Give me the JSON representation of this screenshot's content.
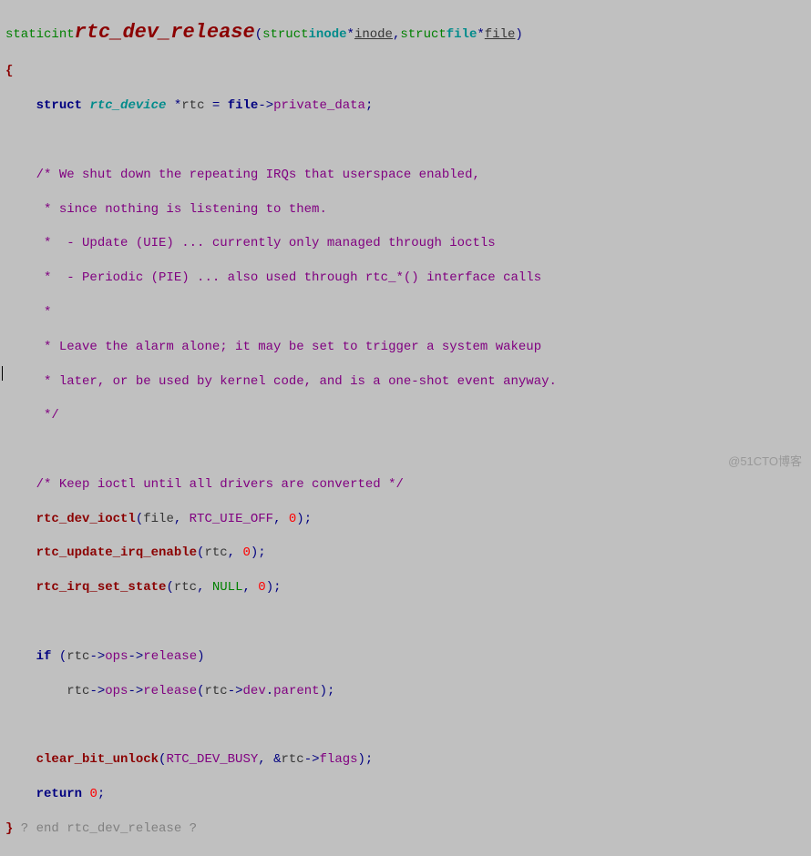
{
  "code": {
    "l1_static": "static",
    "l1_int": "int",
    "l1_fn": "rtc_dev_release",
    "l1_lp": "(",
    "l1_struct1": "struct",
    "l1_inode_t": "inode",
    "l1_star1": "*",
    "l1_inode_p": "inode",
    "l1_comma": ",",
    "l1_struct2": "struct",
    "l1_file_t": "file",
    "l1_star2": "*",
    "l1_file_p": "file",
    "l1_rp": ")",
    "l2_brace": "{",
    "l3_struct": "struct",
    "l3_type": "rtc_device",
    "l3_star": "*",
    "l3_var": "rtc",
    "l3_eq": "=",
    "l3_file": "file",
    "l3_arrow": "->",
    "l3_member": "private_data",
    "l3_semi": ";",
    "c1": "/* We shut down the repeating IRQs that userspace enabled,",
    "c2": " * since nothing is listening to them.",
    "c3": " *  - Update (UIE) ... currently only managed through ioctls",
    "c4": " *  - Periodic (PIE) ... also used through rtc_*() interface calls",
    "c5": " *",
    "c6": " * Leave the alarm alone; it may be set to trigger a system wakeup",
    "c7": " * later, or be used by kernel code, and is a one-shot event anyway.",
    "c8": " */",
    "c9": "/* Keep ioctl until all drivers are converted */",
    "f1_name": "rtc_dev_ioctl",
    "f1_lp": "(",
    "f1_arg1": "file",
    "f1_c1": ",",
    "f1_arg2": "RTC_UIE_OFF",
    "f1_c2": ",",
    "f1_arg3": "0",
    "f1_rp": ");",
    "f2_name": "rtc_update_irq_enable",
    "f2_lp": "(",
    "f2_arg1": "rtc",
    "f2_c1": ",",
    "f2_arg2": "0",
    "f2_rp": ");",
    "f3_name": "rtc_irq_set_state",
    "f3_lp": "(",
    "f3_arg1": "rtc",
    "f3_c1": ",",
    "f3_arg2": "NULL",
    "f3_c2": ",",
    "f3_arg3": "0",
    "f3_rp": ");",
    "if_kw": "if",
    "if_lp": "(",
    "if_rtc1": "rtc",
    "if_ar1": "->",
    "if_ops1": "ops",
    "if_ar2": "->",
    "if_rel1": "release",
    "if_rp": ")",
    "call_rtc": "rtc",
    "call_ar1": "->",
    "call_ops": "ops",
    "call_ar2": "->",
    "call_rel": "release",
    "call_lp": "(",
    "call_rtc2": "rtc",
    "call_ar3": "->",
    "call_dev": "dev",
    "call_dot": ".",
    "call_parent": "parent",
    "call_rp": ");",
    "cb_name": "clear_bit_unlock",
    "cb_lp": "(",
    "cb_arg1": "RTC_DEV_BUSY",
    "cb_c1": ",",
    "cb_amp": "&",
    "cb_rtc": "rtc",
    "cb_ar": "->",
    "cb_flags": "flags",
    "cb_rp": ");",
    "ret_kw": "return",
    "ret_val": "0",
    "ret_semi": ";",
    "end_brace": "}",
    "end_comment": " ? end rtc_dev_release ?"
  },
  "watermark": "@51CTO博客"
}
